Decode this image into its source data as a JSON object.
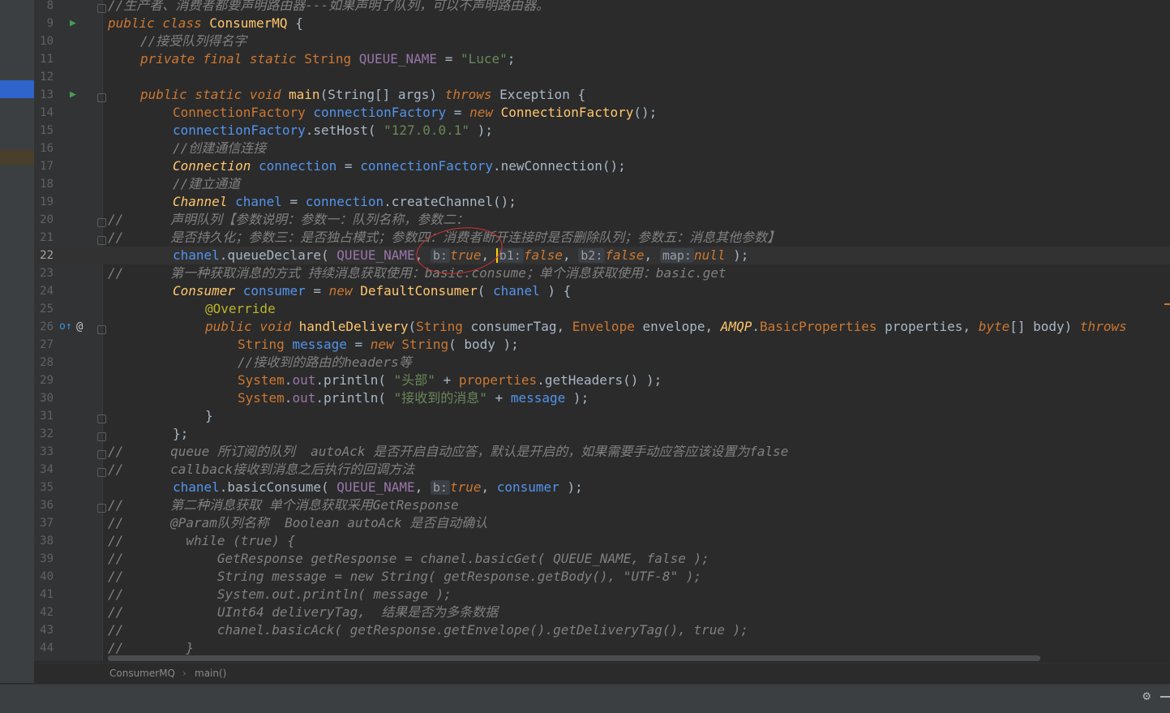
{
  "breadcrumb": [
    "ConsumerMQ",
    "main()"
  ],
  "breadcrumb_sep": "›",
  "gutter_icons": {
    "run_9": "▶",
    "run_13": "▶",
    "override_26": "o↑",
    "at_26": "@"
  },
  "line_numbers": [
    "8",
    "9",
    "10",
    "11",
    "12",
    "13",
    "14",
    "15",
    "16",
    "17",
    "18",
    "19",
    "20",
    "21",
    "22",
    "23",
    "24",
    "25",
    "26",
    "27",
    "28",
    "29",
    "30",
    "31",
    "32",
    "33",
    "34",
    "35",
    "36",
    "37",
    "38",
    "39",
    "40",
    "41",
    "42",
    "43",
    "44"
  ],
  "code": {
    "l8": "//生产者、消费者都要声明路由器---如果声明了队列，可以不声明路由器。",
    "l9": [
      "public class ",
      "ConsumerMQ",
      " {"
    ],
    "l10": "//接受队列得名字",
    "l11": [
      "private final static ",
      "String ",
      "QUEUE_NAME",
      " = ",
      "\"Luce\"",
      ";"
    ],
    "l13": [
      "public static void ",
      "main",
      "(String[] args) ",
      "throws ",
      "Exception {"
    ],
    "l14": [
      "ConnectionFactory ",
      "connectionFactory",
      " = ",
      "new ",
      "ConnectionFactory",
      "();"
    ],
    "l15": [
      "connectionFactory",
      ".setHost( ",
      "\"127.0.0.1\"",
      " );"
    ],
    "l16": "//创建通信连接",
    "l17": [
      "Connection ",
      "connection",
      " = ",
      "connectionFactory",
      ".newConnection();"
    ],
    "l18": "//建立通道",
    "l19": [
      "Channel ",
      "chanel",
      " = ",
      "connection",
      ".createChannel();"
    ],
    "l20": [
      "//",
      "      声明队列【参数说明：参数一：队列名称，参数二："
    ],
    "l21": [
      "//",
      "      是否持久化；参数三：是否独占模式；参数四：消费者断开连接时是否删除队列；参数五：消息其他参数】"
    ],
    "l22": [
      "chanel",
      ".queueDeclare( ",
      "QUEUE_NAME",
      ", ",
      "b:",
      "true",
      ", ",
      "b1:",
      "false",
      ", ",
      "b2:",
      "false",
      ", ",
      "map:",
      "null",
      " );"
    ],
    "l23": [
      "//",
      "      第一种获取消息的方式 持续消息获取使用：basic.consume；单个消息获取使用：basic.get"
    ],
    "l24": [
      "Consumer ",
      "consumer",
      " = ",
      "new ",
      "DefaultConsumer",
      "( ",
      "chanel",
      " ) {"
    ],
    "l25": "@Override",
    "l26": [
      "public void ",
      "handleDelivery",
      "(",
      "String ",
      "consumerTag, ",
      "Envelope ",
      "envelope, ",
      "AMQP",
      ".",
      "BasicProperties ",
      "properties, ",
      "byte",
      "[] ",
      "body) ",
      "throws"
    ],
    "l27": [
      "String ",
      "message",
      " = ",
      "new ",
      "String",
      "( ",
      "body",
      " );"
    ],
    "l28": "//接收到的路由的headers等",
    "l29": [
      "System",
      ".",
      "out",
      ".println( ",
      "\"头部\"",
      " + ",
      "properties",
      ".getHeaders() );"
    ],
    "l30": [
      "System",
      ".",
      "out",
      ".println( ",
      "\"接收到的消息\"",
      " + ",
      "message",
      " );"
    ],
    "l31": "}",
    "l32": "};",
    "l33": [
      "//",
      "      queue 所订阅的队列  autoAck 是否开启自动应答，默认是开启的，如果需要手动应答应该设置为false"
    ],
    "l34": [
      "//",
      "      callback接收到消息之后执行的回调方法"
    ],
    "l35": [
      "chanel",
      ".basicConsume( ",
      "QUEUE_NAME",
      ", ",
      "b:",
      "true",
      ", ",
      "consumer",
      " );"
    ],
    "l36": [
      "//",
      "      第二种消息获取 单个消息获取采用GetResponse"
    ],
    "l37": [
      "//",
      "      @Param队列名称  Boolean autoAck 是否自动确认"
    ],
    "l38": [
      "//",
      "        while (true) {"
    ],
    "l39": [
      "//",
      "            GetResponse getResponse = chanel.basicGet( QUEUE_NAME, false );"
    ],
    "l40": [
      "//",
      "            String message = new String( getResponse.getBody(), \"UTF-8\" );"
    ],
    "l41": [
      "//",
      "            System.out.println( message );"
    ],
    "l42": [
      "//",
      "            UInt64 deliveryTag,  结果是否为多条数据"
    ],
    "l43": [
      "//",
      "            chanel.basicAck( getResponse.getEnvelope().getDeliveryTag(), true );"
    ],
    "l44": [
      "//",
      "        }"
    ]
  },
  "status": {
    "gear_icon": "⚙",
    "dash": "—"
  },
  "colors": {
    "keyword": "#cc7832",
    "string": "#6a8759",
    "field": "#9876aa",
    "comment": "#808080",
    "method": "#ffc66d",
    "identifier": "#5394ec"
  }
}
